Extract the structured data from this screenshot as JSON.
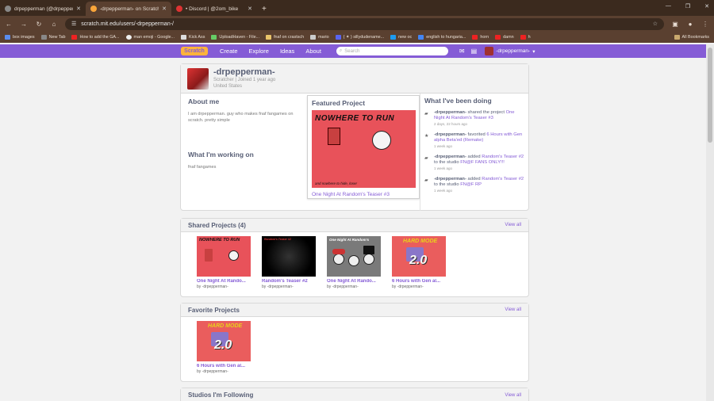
{
  "browser": {
    "tabs": [
      {
        "title": "drpepperman (@drpepperman",
        "active": false
      },
      {
        "title": "-drpepperman- on Scratch",
        "active": true
      },
      {
        "title": "• Discord | @2om_bike",
        "active": false
      }
    ],
    "new_tab": "+",
    "url": "scratch.mit.edu/users/-drpepperman-/",
    "bookmarks": [
      "box images",
      "New Tab",
      "How to add the GA...",
      "man emoji - Google...",
      "Kick Ass",
      "UploadHaven - File...",
      "fnaf on crastsch",
      "mario",
      "( ✦ ) sillydudename...",
      "new oc",
      "english to hungaria...",
      "horn",
      "damn",
      "h"
    ],
    "all_bookmarks": "All Bookmarks"
  },
  "nav": {
    "logo": "Scratch",
    "links": [
      "Create",
      "Explore",
      "Ideas",
      "About"
    ],
    "search_placeholder": "Search",
    "username": "-drpepperman-"
  },
  "profile": {
    "username": "-drpepperman-",
    "role_joined": "Scratcher | Joined 1 year ago",
    "country": "United States",
    "about_heading": "About me",
    "about_text": "I am drpepperman. guy who makes fnaf fangames on scratch. pretty simple",
    "working_heading": "What I'm working on",
    "working_text": "fnaf fangames",
    "featured_heading": "Featured Project",
    "featured_title": "One Night At Random's Teaser #3",
    "featured_thumb_top": "NOWHERE TO RUN",
    "featured_thumb_bottom": "and nowhere to hide, loser",
    "activity_heading": "What I've been doing",
    "activity": [
      {
        "user": "-drpepperman-",
        "verb": "shared the project",
        "target": "One Night At Random's Teaser #3",
        "extra": "",
        "extra_link": "",
        "time": "2 days, 22 hours ago",
        "icon": "share"
      },
      {
        "user": "-drpepperman-",
        "verb": "favorited",
        "target": "6 Hours with Gen alpha Beta'ed (Remake)",
        "extra": "",
        "extra_link": "",
        "time": "1 week ago",
        "icon": "star"
      },
      {
        "user": "-drpepperman-",
        "verb": "added",
        "target": "Random's Teaser #2",
        "extra": "to the studio",
        "extra_link": "FN@F FANS ONLY!!!",
        "time": "1 week ago",
        "icon": "studio"
      },
      {
        "user": "-drpepperman-",
        "verb": "added",
        "target": "Random's Teaser #2",
        "extra": "to the studio",
        "extra_link": "FN@F RP",
        "time": "1 week ago",
        "icon": "studio"
      }
    ]
  },
  "shared": {
    "title": "Shared Projects (4)",
    "view_all": "View all",
    "projects": [
      {
        "name": "One Night At Rando...",
        "by": "by -drpepperman-",
        "thumb": "nw",
        "cap": "NOWHERE TO RUN"
      },
      {
        "name": "Random's Teaser #2",
        "by": "by -drpepperman-",
        "thumb": "dark",
        "cap": "Random's Teaser #2"
      },
      {
        "name": "One Night At Rando...",
        "by": "by -drpepperman-",
        "thumb": "nr",
        "cap": "One Night At Random's"
      },
      {
        "name": "6 Hours with Gen al...",
        "by": "by -drpepperman-",
        "thumb": "hm",
        "cap": "HARD MODE"
      }
    ]
  },
  "favorites": {
    "title": "Favorite Projects",
    "view_all": "View all",
    "projects": [
      {
        "name": "6 Hours with Gen al...",
        "by": "by -drpepperman-",
        "thumb": "hm",
        "cap": "HARD MODE"
      }
    ]
  },
  "studios": {
    "title": "Studios I'm Following",
    "view_all": "View all"
  },
  "thumb_big_text": "2.0",
  "colors": {
    "accent": "#855cd6",
    "chrome": "#5a4030",
    "tabbar": "#3b2a1e"
  }
}
